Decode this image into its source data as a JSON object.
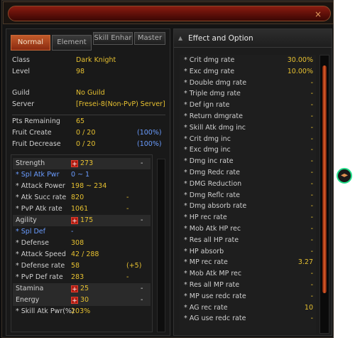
{
  "window": {
    "close_icon": "×"
  },
  "tabs": [
    {
      "label": "Normal",
      "active": true
    },
    {
      "label": "Element",
      "active": false
    },
    {
      "label": "Skill Enhar",
      "active": false
    },
    {
      "label": "Master",
      "active": false
    }
  ],
  "info": [
    {
      "label": "Class",
      "value": "Dark Knight"
    },
    {
      "label": "Level",
      "value": "98"
    },
    {
      "label": "Guild",
      "value": "No Guild"
    },
    {
      "label": "Server",
      "value": "[Fresei-8(Non-PvP) Server]"
    }
  ],
  "points": [
    {
      "label": "Pts Remaining",
      "value": "65",
      "pct": ""
    },
    {
      "label": "Fruit Create",
      "value": "0 / 20",
      "pct": "(100%)"
    },
    {
      "label": "Fruit Decrease",
      "value": "0 / 20",
      "pct": "(100%)"
    }
  ],
  "stats": {
    "strength": {
      "label": "Strength",
      "value": "273",
      "dash": "-"
    },
    "str_rows": [
      {
        "label": "* Spl Atk Pwr",
        "value": "0 ~ 1",
        "extra": "",
        "blue": true
      },
      {
        "label": "* Attack Power",
        "value": "198 ~ 234",
        "extra": "",
        "blue": false
      },
      {
        "label": "* Atk Succ rate",
        "value": "820",
        "extra": "-",
        "blue": false
      },
      {
        "label": "* PvP Atk rate",
        "value": "1061",
        "extra": "-",
        "blue": false
      }
    ],
    "agility": {
      "label": "Agility",
      "value": "175",
      "dash": "-"
    },
    "agi_rows": [
      {
        "label": "* Spl Def",
        "value": "-",
        "extra": "",
        "blue": true
      },
      {
        "label": "* Defense",
        "value": "308",
        "extra": "",
        "blue": false
      },
      {
        "label": "* Attack Speed",
        "value": "42 / 288",
        "extra": "",
        "blue": false
      },
      {
        "label": "* Defense rate",
        "value": "58",
        "extra": "(+5)",
        "blue": false
      },
      {
        "label": "* PvP Def rate",
        "value": "283",
        "extra": "-",
        "blue": false
      }
    ],
    "stamina": {
      "label": "Stamina",
      "value": "25",
      "dash": "-"
    },
    "energy": {
      "label": "Energy",
      "value": "30",
      "dash": "-"
    },
    "skill": {
      "label": "* Skill Atk Pwr(%)",
      "value": "203%"
    }
  },
  "effect": {
    "title": "Effect and Option",
    "options": [
      {
        "label": "* Crit dmg rate",
        "value": "30.00%"
      },
      {
        "label": "* Exc dmg rate",
        "value": "10.00%"
      },
      {
        "label": "* Double dmg rate",
        "value": "-"
      },
      {
        "label": "* Triple dmg rate",
        "value": "-"
      },
      {
        "label": "* Def ign rate",
        "value": "-"
      },
      {
        "label": "* Return dmgrate",
        "value": "-"
      },
      {
        "label": "* Skill Atk dmg inc",
        "value": "-"
      },
      {
        "label": "* Crit dmg inc",
        "value": "-"
      },
      {
        "label": "* Exc dmg inc",
        "value": "-"
      },
      {
        "label": "* Dmg inc rate",
        "value": "-"
      },
      {
        "label": "* Dmg Redc rate",
        "value": "-"
      },
      {
        "label": "* DMG Reduction",
        "value": "-"
      },
      {
        "label": "* Dmg Reflc rate",
        "value": "-"
      },
      {
        "label": "* Dmg absorb rate",
        "value": "-"
      },
      {
        "label": "* HP rec rate",
        "value": "-"
      },
      {
        "label": "* Mob Atk HP rec",
        "value": "-"
      },
      {
        "label": "* Res all HP rate",
        "value": "-"
      },
      {
        "label": "* HP absorb",
        "value": "-"
      },
      {
        "label": "* MP rec rate",
        "value": "3.27"
      },
      {
        "label": "* Mob Atk MP rec",
        "value": "-"
      },
      {
        "label": "* Res all MP rate",
        "value": "-"
      },
      {
        "label": "* MP use redc rate",
        "value": "-"
      },
      {
        "label": "* AG rec rate",
        "value": "10"
      },
      {
        "label": "* AG use redc rate",
        "value": "-"
      }
    ]
  }
}
